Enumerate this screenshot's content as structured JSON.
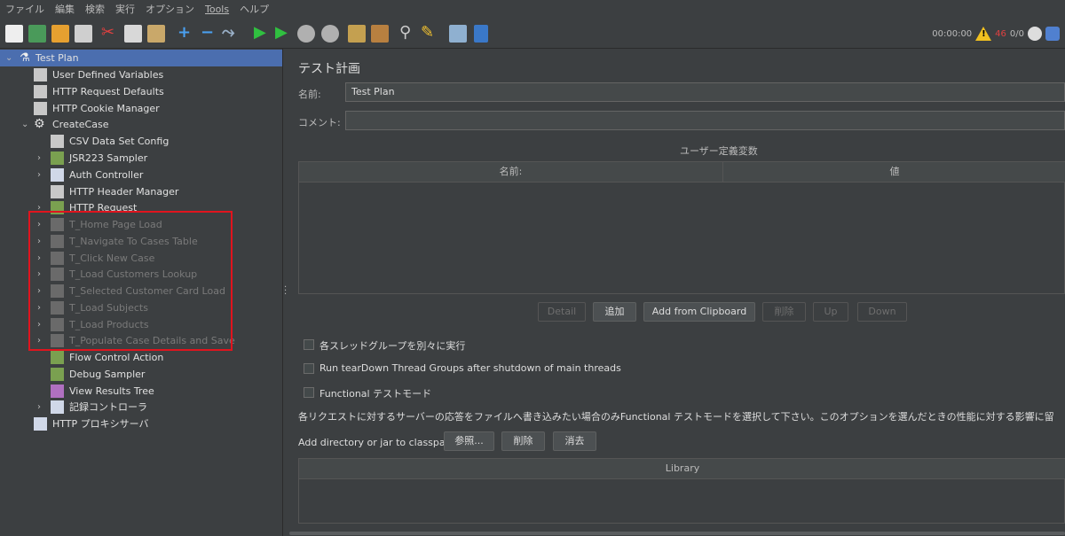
{
  "menu": [
    "ファイル",
    "編集",
    "検索",
    "実行",
    "オプション",
    "Tools",
    "ヘルプ"
  ],
  "status": {
    "timer": "00:00:00",
    "warn_count": "46",
    "threads": "0/0"
  },
  "tree": {
    "root": "Test Plan",
    "items": [
      {
        "label": "User Defined Variables"
      },
      {
        "label": "HTTP Request Defaults"
      },
      {
        "label": "HTTP Cookie Manager"
      },
      {
        "label": "CreateCase"
      },
      {
        "label": "CSV Data Set Config"
      },
      {
        "label": "JSR223 Sampler"
      },
      {
        "label": "Auth Controller"
      },
      {
        "label": "HTTP Header Manager"
      },
      {
        "label": "HTTP Request"
      },
      {
        "label": "T_Home Page Load"
      },
      {
        "label": "T_Navigate To Cases Table"
      },
      {
        "label": "T_Click New Case"
      },
      {
        "label": "T_Load Customers Lookup"
      },
      {
        "label": "T_Selected Customer Card Load"
      },
      {
        "label": "T_Load Subjects"
      },
      {
        "label": "T_Load Products"
      },
      {
        "label": "T_Populate Case Details and Save"
      },
      {
        "label": "Flow Control Action"
      },
      {
        "label": "Debug Sampler"
      },
      {
        "label": "View Results Tree"
      },
      {
        "label": "記録コントローラ"
      },
      {
        "label": "HTTP プロキシサーバ"
      }
    ]
  },
  "panel": {
    "title": "テスト計画",
    "name_label": "名前:",
    "name_value": "Test Plan",
    "comment_label": "コメント:",
    "comment_value": "",
    "udv_title": "ユーザー定義変数",
    "udv_col_name": "名前:",
    "udv_col_value": "値",
    "buttons": {
      "detail": "Detail",
      "add": "追加",
      "add_clip": "Add from Clipboard",
      "delete": "削除",
      "up": "Up",
      "down": "Down"
    },
    "chk_separate": "各スレッドグループを別々に実行",
    "chk_teardown": "Run tearDown Thread Groups after shutdown of main threads",
    "chk_functional": "Functional テストモード",
    "functional_desc": "各リクエストに対するサーバーの応答をファイルへ書き込みたい場合のみFunctional テストモードを選択して下さい。このオプションを選んだときの性能に対する影響に留",
    "classpath_label": "Add directory or jar to classpath",
    "cp_browse": "参照...",
    "cp_delete": "削除",
    "cp_clear": "消去",
    "library_col": "Library"
  }
}
